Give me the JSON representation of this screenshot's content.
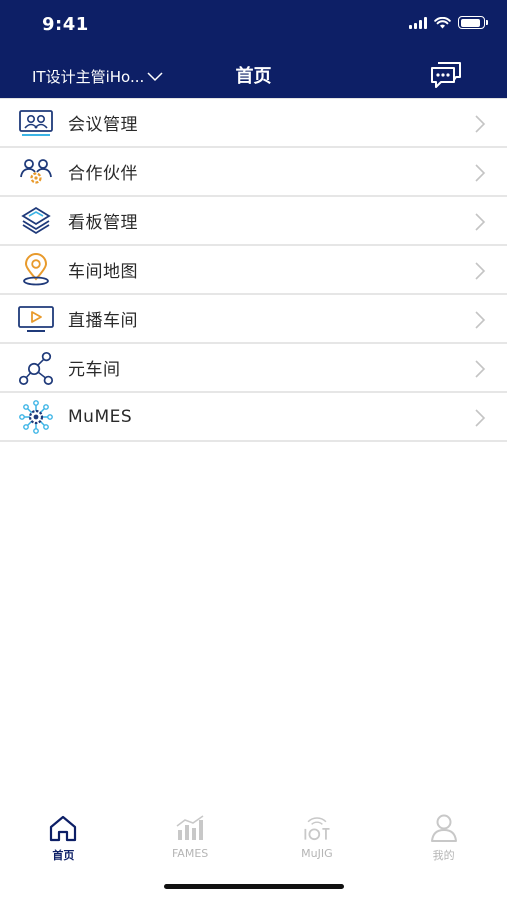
{
  "status_bar": {
    "time": "9:41",
    "battery_level": 0.9,
    "signal_bars": 4
  },
  "nav": {
    "org_selector": "IT设计主管iHo...",
    "title": "首页",
    "chat_icon": "chat-bubbles-icon"
  },
  "colors": {
    "header_bg": "#0d1f66",
    "accent": "#0d1f66",
    "inactive": "#b5b5b5",
    "icon_blue": "#1f3a7a",
    "icon_orange": "#e89a2c",
    "icon_cyan": "#3cb4e6"
  },
  "menu": [
    {
      "label": "会议管理",
      "icon": "meeting-icon"
    },
    {
      "label": "合作伙伴",
      "icon": "partners-icon"
    },
    {
      "label": "看板管理",
      "icon": "kanban-layers-icon"
    },
    {
      "label": "车间地图",
      "icon": "map-pin-icon"
    },
    {
      "label": "直播车间",
      "icon": "live-video-icon"
    },
    {
      "label": "元车间",
      "icon": "network-nodes-icon"
    },
    {
      "label": "MuMES",
      "icon": "mumes-gear-icon"
    }
  ],
  "tabbar": [
    {
      "label": "首页",
      "icon": "home-icon",
      "active": true
    },
    {
      "label": "FAMES",
      "icon": "bar-chart-icon",
      "active": false
    },
    {
      "label": "MuJIG",
      "icon": "iot-icon",
      "active": false
    },
    {
      "label": "我的",
      "icon": "profile-icon",
      "active": false
    }
  ]
}
